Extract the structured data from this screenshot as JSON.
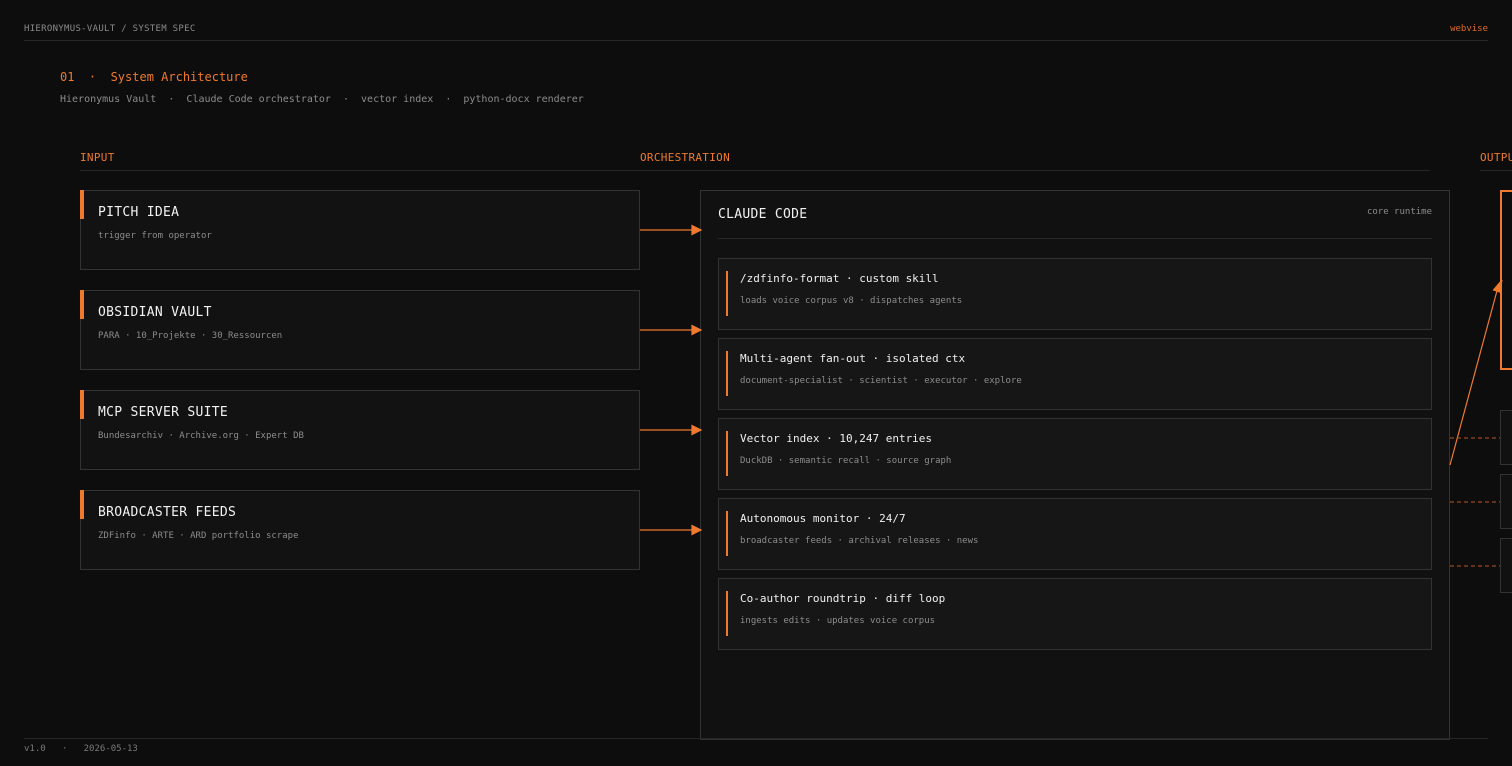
{
  "header": {
    "breadcrumb": "HIERONYMUS-VAULT / SYSTEM SPEC",
    "brand": "webvise"
  },
  "section": {
    "title": "01  ·  System Architecture",
    "subtitle": "Hieronymus Vault  ·  Claude Code orchestrator  ·  vector index  ·  python-docx renderer"
  },
  "columns": {
    "input": "INPUT",
    "orchestration": "ORCHESTRATION",
    "output": "OUTPUT"
  },
  "inputs": [
    {
      "title": "PITCH IDEA",
      "subtitle": "trigger from operator"
    },
    {
      "title": "OBSIDIAN VAULT",
      "subtitle": "PARA · 10_Projekte · 30_Ressourcen"
    },
    {
      "title": "MCP SERVER SUITE",
      "subtitle": "Bundesarchiv · Archive.org · Expert DB"
    },
    {
      "title": "BROADCASTER FEEDS",
      "subtitle": "ZDFinfo · ARTE · ARD portfolio scrape"
    }
  ],
  "orchestrator": {
    "title": "CLAUDE CODE",
    "tag": "core runtime",
    "items": [
      {
        "title": "/zdfinfo-format · custom skill",
        "subtitle": "loads voice corpus v8 · dispatches agents"
      },
      {
        "title": "Multi-agent fan-out · isolated ctx",
        "subtitle": "document-specialist · scientist · executor · explore"
      },
      {
        "title": "Vector index · 10,247 entries",
        "subtitle": "DuckDB · semantic recall · source graph"
      },
      {
        "title": "Autonomous monitor · 24/7",
        "subtitle": "broadcaster feeds · archival releases · news"
      },
      {
        "title": "Co-author roundtrip · diff loop",
        "subtitle": "ingests edits · updates voice corpus"
      }
    ]
  },
  "footer": {
    "version": "v1.0",
    "separator": "·",
    "date": "2026-05-13"
  },
  "colors": {
    "accent": "#ef7a2e",
    "background": "#0d0d0d",
    "border": "#333333"
  }
}
